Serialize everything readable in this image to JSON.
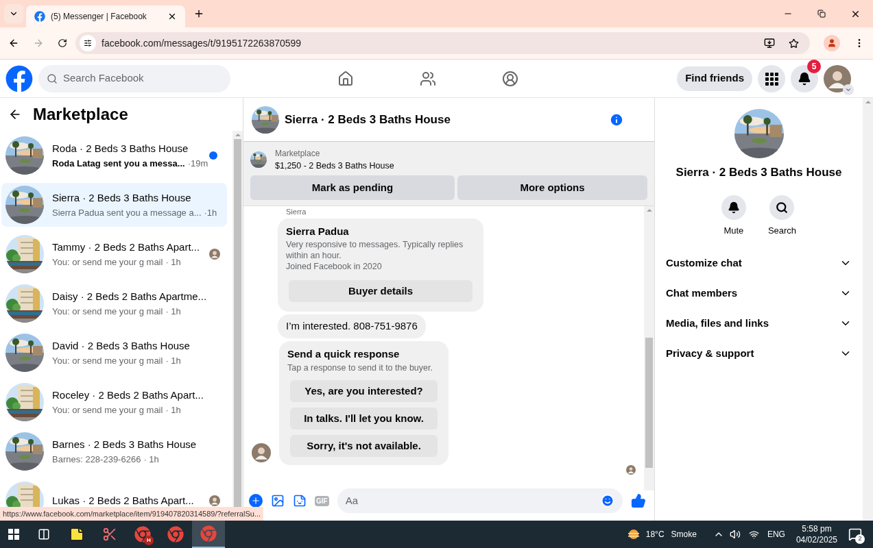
{
  "browser": {
    "tab": {
      "title": "(5) Messenger | Facebook",
      "selected": true
    },
    "address": "facebook.com/messages/t/9195172263870599"
  },
  "nav": {
    "search_placeholder": "Search Facebook",
    "find_friends": "Find friends",
    "notification_count": "5"
  },
  "sidebar": {
    "title": "Marketplace",
    "conversations": [
      {
        "name": "Roda · 2 Beds 3 Baths House",
        "preview": "Roda Latag sent you a messa...",
        "time": "·19m",
        "kind": "house",
        "unread": true,
        "seen": false,
        "selected": false
      },
      {
        "name": "Sierra · 2 Beds 3 Baths House",
        "preview": "Sierra Padua sent you a message a...",
        "time": "·1h",
        "kind": "house",
        "unread": false,
        "seen": false,
        "selected": true
      },
      {
        "name": "Tammy · 2 Beds 2 Baths Apart...",
        "preview": "You: or send me your g mail",
        "time": "· 1h",
        "kind": "apartment",
        "unread": false,
        "seen": true,
        "selected": false
      },
      {
        "name": "Daisy · 2 Beds 2 Baths Apartme...",
        "preview": "You: or send me your g mail",
        "time": "· 1h",
        "kind": "apartment",
        "unread": false,
        "seen": false,
        "selected": false
      },
      {
        "name": "David · 2 Beds 3 Baths House",
        "preview": "You: or send me your g mail",
        "time": "· 1h",
        "kind": "house",
        "unread": false,
        "seen": false,
        "selected": false
      },
      {
        "name": "Roceley · 2 Beds 2 Baths Apart...",
        "preview": "You: or send me your g mail",
        "time": "· 1h",
        "kind": "apartment",
        "unread": false,
        "seen": false,
        "selected": false
      },
      {
        "name": "Barnes · 2 Beds 3 Baths House",
        "preview": "Barnes: 228-239-6266",
        "time": "· 1h",
        "kind": "house",
        "unread": false,
        "seen": false,
        "selected": false
      },
      {
        "name": "Lukas · 2 Beds 2 Baths Apart...",
        "kind": "apartment",
        "unread": false,
        "seen": true,
        "selected": false
      }
    ]
  },
  "chat": {
    "title": "Sierra · 2 Beds 3 Baths House",
    "listing": {
      "source": "Marketplace",
      "summary": "$1,250 - 2 Beds 3 Baths House",
      "actions": [
        "Mark as pending",
        "More options"
      ]
    },
    "messages": [
      {
        "kind": "sender_label",
        "text": "Sierra"
      },
      {
        "kind": "profile_card",
        "name": "Sierra Padua",
        "lines": [
          "Very responsive to messages. Typically replies within an hour.",
          "Joined Facebook in 2020"
        ],
        "button": "Buyer details"
      },
      {
        "kind": "text",
        "text": "I’m interested. 808-751-9876"
      },
      {
        "kind": "quick_responses",
        "title": "Send a quick response",
        "subtitle": "Tap a response to send it to the buyer.",
        "options": [
          "Yes, are you interested?",
          "In talks. I'll let you know.",
          "Sorry, it's not available."
        ]
      }
    ],
    "composer": {
      "placeholder": "Aa",
      "gif_label": "GIF"
    }
  },
  "details": {
    "title": "Sierra · 2 Beds 3 Baths House",
    "actions": [
      {
        "kind": "mute",
        "label": "Mute"
      },
      {
        "kind": "search",
        "label": "Search"
      }
    ],
    "sections": [
      {
        "label": "Customize chat",
        "expanded": false
      },
      {
        "label": "Chat members",
        "expanded": false
      },
      {
        "label": "Media, files and links",
        "expanded": false
      },
      {
        "label": "Privacy & support",
        "expanded": false
      }
    ]
  },
  "status_url": "https://www.facebook.com/marketplace/item/919407820314589/?referralSu...",
  "taskbar": {
    "apps": [
      {
        "kind": "taskview",
        "selected": false
      },
      {
        "kind": "notes",
        "selected": false
      },
      {
        "kind": "snip",
        "selected": false
      },
      {
        "kind": "chrome",
        "badge": "H",
        "selected": false
      },
      {
        "kind": "chrome",
        "selected": false
      },
      {
        "kind": "chrome",
        "selected": true
      }
    ],
    "weather": {
      "temp": "18°C",
      "condition": "Smoke"
    },
    "language": "ENG",
    "time": "5:58 pm",
    "date": "04/02/2025",
    "notifications": "2"
  }
}
